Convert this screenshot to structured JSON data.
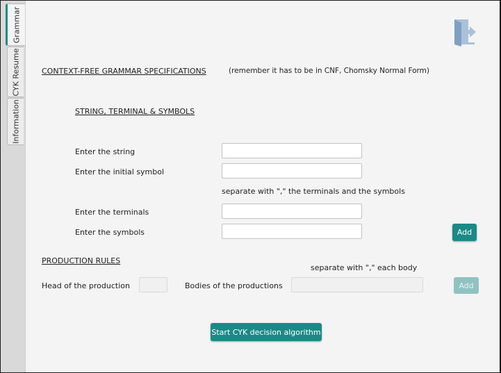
{
  "tabs": [
    {
      "label": "Grammar",
      "active": true
    },
    {
      "label": "CYK Resume",
      "active": false
    },
    {
      "label": "Information",
      "active": false
    }
  ],
  "icons": {
    "exit": "exit-door-icon"
  },
  "colors": {
    "accent": "#1a8a87",
    "accent_disabled": "#8fc3c1"
  },
  "grammar": {
    "title": "CONTEXT-FREE GRAMMAR SPECIFICATIONS",
    "note": "(remember it has to be in CNF, Chomsky Normal Form)",
    "section_title": "STRING, TERMINAL & SYMBOLS",
    "string_label": "Enter the string",
    "string_value": "",
    "initial_label": "Enter the initial symbol",
    "initial_value": "",
    "separator_hint": "separate with \",\" the terminals and the symbols",
    "terminals_label": "Enter the terminals",
    "terminals_value": "",
    "symbols_label": "Enter the symbols",
    "symbols_value": "",
    "add_label": "Add"
  },
  "production": {
    "title": "PRODUCTION RULES",
    "separator_hint": "separate with \",\" each body",
    "head_label": "Head of the production",
    "head_value": "",
    "bodies_label": "Bodies of the productions",
    "bodies_value": "",
    "add_label": "Add"
  },
  "start_label": "Start CYK decision algorithm"
}
